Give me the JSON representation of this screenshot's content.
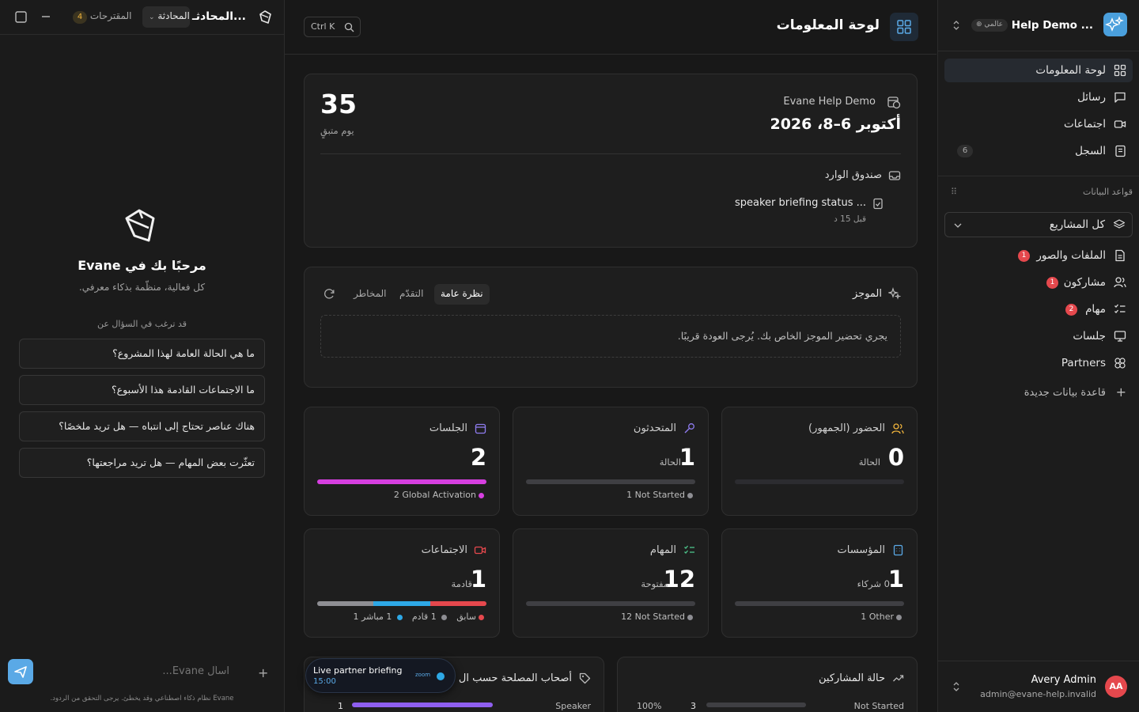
{
  "chat": {
    "title": "المحادثـ...",
    "tab_conversation": "المحادثة",
    "tab_suggestions": "المقترحات",
    "suggestions_count": "4",
    "welcome_title": "مرحبًا بك في Evane",
    "welcome_subtitle": "كل فعالية، منظّمة بذكاء معرفي.",
    "ask_heading": "قد ترغب في السؤال عن",
    "suggestions": [
      "ما هي الحالة العامة لهذا المشروع؟",
      "ما الاجتماعات القادمة هذا الأسبوع؟",
      "هناك عناصر تحتاج إلى انتباه — هل تريد ملخصًا؟",
      "تعثّرت بعض المهام — هل تريد مراجعتها؟"
    ],
    "input_placeholder": "اسأل Evane...",
    "disclaimer": "Evane نظام ذكاء اصطناعي وقد يخطئ. يرجى التحقق من الردود."
  },
  "header": {
    "shortcut": "Ctrl K",
    "title": "لوحة المعلومات"
  },
  "event": {
    "days": "35",
    "days_label": "يوم متبقٍ",
    "name": "Evane Help Demo",
    "date": "أكتوبر 6–8، 2026",
    "inbox_label": "صندوق الوارد",
    "inbox_item": "speaker briefing status ...",
    "inbox_time": "قبل 15 د"
  },
  "brief": {
    "title": "الموجز",
    "tabs": [
      "نظرة عامة",
      "التقدّم",
      "المخاطر"
    ],
    "message": "يجري تحضير الموجز الخاص بك. يُرجى العودة قريبًا."
  },
  "stats": {
    "sessions": {
      "title": "الجلسات",
      "value": "2",
      "sub": "",
      "legend": "Global Activation",
      "legend_count": "2",
      "progress": 1.0,
      "color": "#d63fe0"
    },
    "speakers": {
      "title": "المتحدثون",
      "value": "1",
      "sub": "الحالة",
      "legend": "Not Started",
      "legend_count": "1",
      "progress": 0,
      "color": "#8e8e93"
    },
    "attendance": {
      "title": "الحضور (الجمهور)",
      "value": "0",
      "sub": "الحالة"
    },
    "meetings": {
      "title": "الاجتماعات",
      "value": "1",
      "sub": "قادمة",
      "legend": [
        {
          "label": "مباشر",
          "count": "1",
          "color": "#e5484d"
        },
        {
          "label": "قادم",
          "count": "1",
          "color": "#2ea8e6"
        },
        {
          "label": "سابق",
          "count": "1",
          "color": "#8e8e93"
        }
      ]
    },
    "tasks": {
      "title": "المهام",
      "value": "12",
      "sub": "مفتوحة",
      "legend": "Not Started",
      "legend_count": "12"
    },
    "orgs": {
      "title": "المؤسسات",
      "value": "1",
      "sub": "0 شركاء",
      "legend": "Other",
      "legend_count": "1"
    }
  },
  "stakeholders": {
    "title": "أصحاب المصلحة حسب ال",
    "row_label": "Speaker",
    "row_value": "1",
    "progress": 1.0
  },
  "participants": {
    "title": "حالة المشاركين",
    "row_label": "Not Started",
    "row_value": "3",
    "row_pct": "100%"
  },
  "toast": {
    "title": "Live partner briefing",
    "time": "15:00",
    "app": "zoom"
  },
  "sidebar": {
    "workspace": "Help Demo ...",
    "badge": "عالمي",
    "nav": [
      {
        "label": "لوحة المعلومات"
      },
      {
        "label": "رسائل"
      },
      {
        "label": "اجتماعات"
      },
      {
        "label": "السجل",
        "count": "6"
      }
    ],
    "db_heading": "قواعد البيانات",
    "all_projects": "كل المشاريع",
    "db_items": [
      {
        "label": "الملفات والصور",
        "badge": "1"
      },
      {
        "label": "مشاركون",
        "badge": "1"
      },
      {
        "label": "مهام",
        "badge": "2"
      },
      {
        "label": "جلسات",
        "badge": ""
      },
      {
        "label": "Partners",
        "badge": ""
      }
    ],
    "new_db": "قاعدة بيانات جديدة"
  },
  "user": {
    "initials": "AA",
    "name": "Avery Admin",
    "email": "admin@evane-help.invalid"
  }
}
